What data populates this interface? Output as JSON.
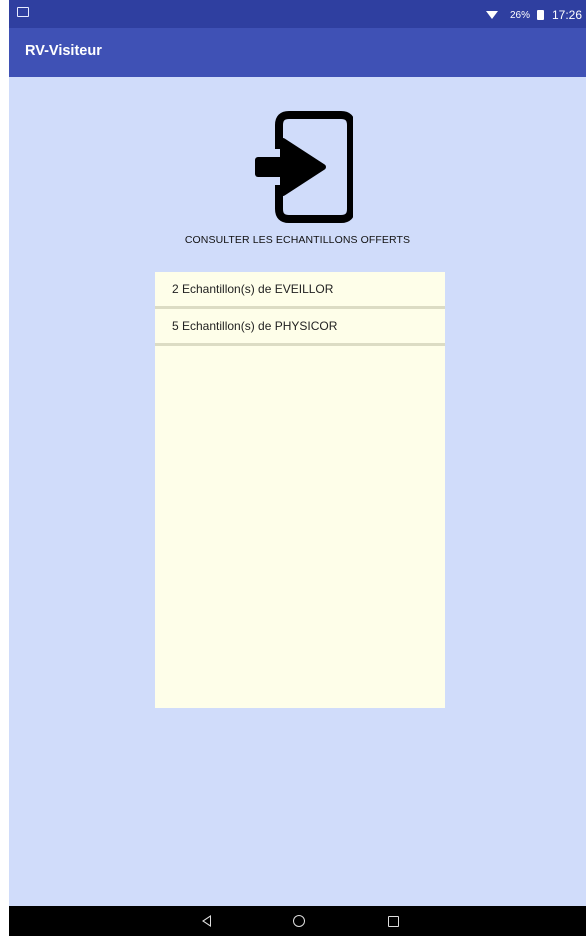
{
  "status_bar": {
    "battery_pct": "26%",
    "time": "17:26",
    "icons": [
      "image-notification-icon",
      "wifi-icon",
      "battery-icon"
    ]
  },
  "app_bar": {
    "title": "RV-Visiteur"
  },
  "main": {
    "icon": "login-arrow-icon",
    "heading": "CONSULTER LES ECHANTILLONS OFFERTS",
    "items": [
      {
        "label": "2 Echantillon(s) de EVEILLOR"
      },
      {
        "label": "5 Echantillon(s) de PHYSICOR"
      }
    ]
  },
  "nav_bar": {
    "icons": [
      "back-icon",
      "home-icon",
      "recents-icon"
    ]
  },
  "colors": {
    "status_bar": "#2f3fa0",
    "app_bar": "#3f51b5",
    "background": "#d0dcfa",
    "list_background": "#fefee9"
  }
}
